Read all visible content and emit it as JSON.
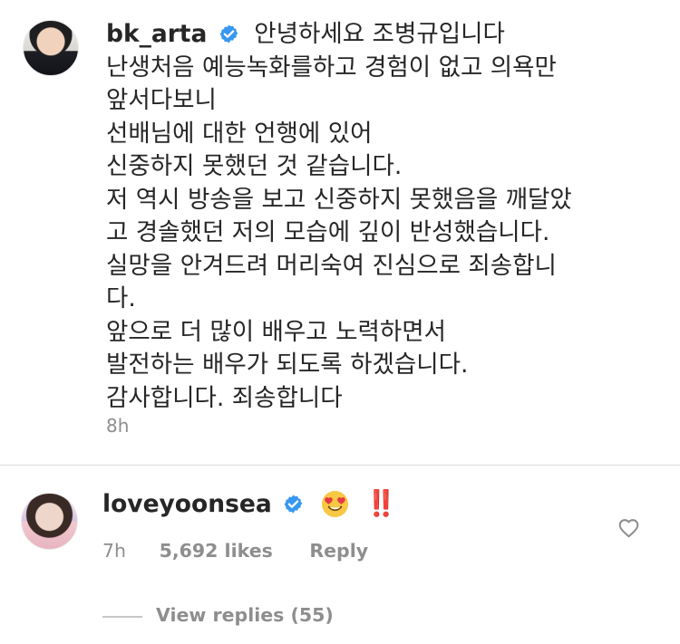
{
  "comments": [
    {
      "username": "bk_arta",
      "verified": true,
      "lines": [
        "안녕하세요 조병규입니다",
        "난생처음 예능녹화를하고 경험이 없고 의욕만",
        "앞서다보니",
        "선배님에 대한 언행에 있어",
        "신중하지 못했던 것 같습니다.",
        "저 역시 방송을 보고 신중하지 못했음을 깨달았",
        "고 경솔했던 저의 모습에 깊이 반성했습니다.",
        "실망을 안겨드려 머리숙여 진심으로 죄송합니",
        "다.",
        "앞으로 더 많이 배우고 노력하면서",
        "발전하는 배우가 되도록 하겠습니다.",
        "감사합니다. 죄송합니다"
      ],
      "time": "8h"
    },
    {
      "username": "loveyoonsea",
      "verified": true,
      "text": "‼️",
      "emoji": "heart-eyes-emoji",
      "time": "7h",
      "likes": "5,692 likes",
      "reply_label": "Reply",
      "view_replies": "View replies (55)"
    }
  ],
  "colors": {
    "text": "#262626",
    "meta": "#8e8e8e",
    "verified": "#3897f0",
    "separator": "#dbdbdb",
    "exclamation": "#ed2d2d"
  },
  "icons": {
    "verified": "verified-badge-icon",
    "like": "heart-outline-icon"
  }
}
